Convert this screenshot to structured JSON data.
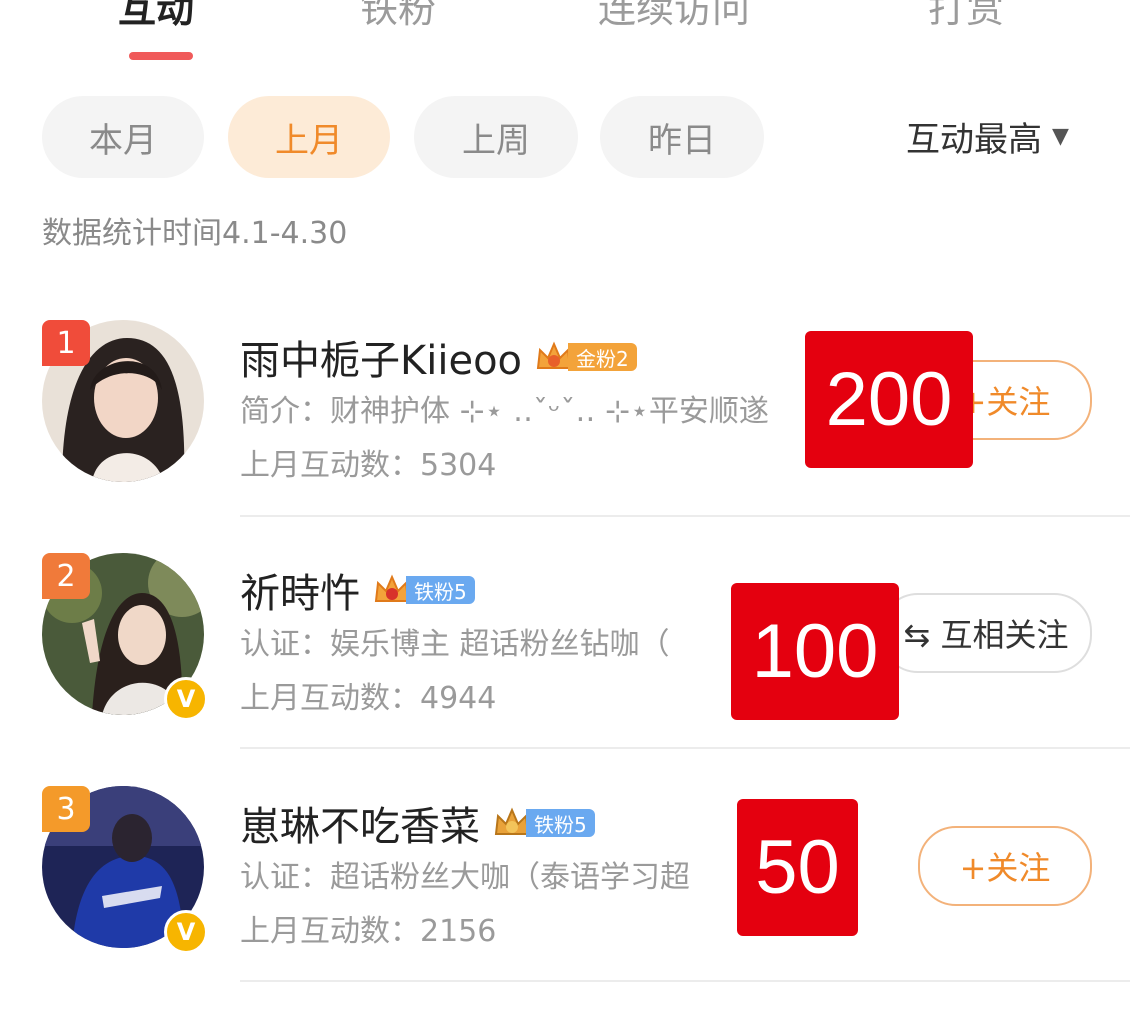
{
  "tabs": [
    {
      "label": "互动",
      "active": true
    },
    {
      "label": "铁粉",
      "active": false
    },
    {
      "label": "连续访问",
      "active": false
    },
    {
      "label": "打赏",
      "active": false
    }
  ],
  "filters": [
    {
      "label": "本月",
      "active": false
    },
    {
      "label": "上月",
      "active": true
    },
    {
      "label": "上周",
      "active": false
    },
    {
      "label": "昨日",
      "active": false
    }
  ],
  "sort": {
    "label": "互动最高",
    "icon": "caret-down-icon"
  },
  "stat_time": "数据统计时间4.1-4.30",
  "users": [
    {
      "rank": "1",
      "rank_color": "#f04c3a",
      "name": "雨中栀子Kiieoo",
      "fan_badge": "金粉2",
      "fan_badge_color": "#f3a33a",
      "bio": "简介：财神护体 ⊹⋆ ‥ˇᵕˇ‥ ⊹⋆平安顺遂",
      "interaction_count": "上月互动数：5304",
      "follow_label": "+关注",
      "follow_style": "orange",
      "verified": false,
      "overlay_value": "200"
    },
    {
      "rank": "2",
      "rank_color": "#f07a3a",
      "name": "祈時忤",
      "fan_badge": "铁粉5",
      "fan_badge_color": "#6aa9f0",
      "bio": "认证：娱乐博主 超话粉丝钻咖（",
      "interaction_count": "上月互动数：4944",
      "follow_label": "⇆ 互相关注",
      "follow_style": "gray",
      "verified": true,
      "overlay_value": "100"
    },
    {
      "rank": "3",
      "rank_color": "#f49a2a",
      "name": "崽琳不吃香菜",
      "fan_badge": "铁粉5",
      "fan_badge_color": "#6aa9f0",
      "bio": "认证：超话粉丝大咖（泰语学习超",
      "interaction_count": "上月互动数：2156",
      "follow_label": "+关注",
      "follow_style": "orange",
      "verified": true,
      "overlay_value": "50"
    }
  ],
  "colors": {
    "accent": "#f05a5a",
    "chip_active_bg": "#fdebd7",
    "chip_active_text": "#f08a2a",
    "overlay_red": "#e4000f"
  }
}
